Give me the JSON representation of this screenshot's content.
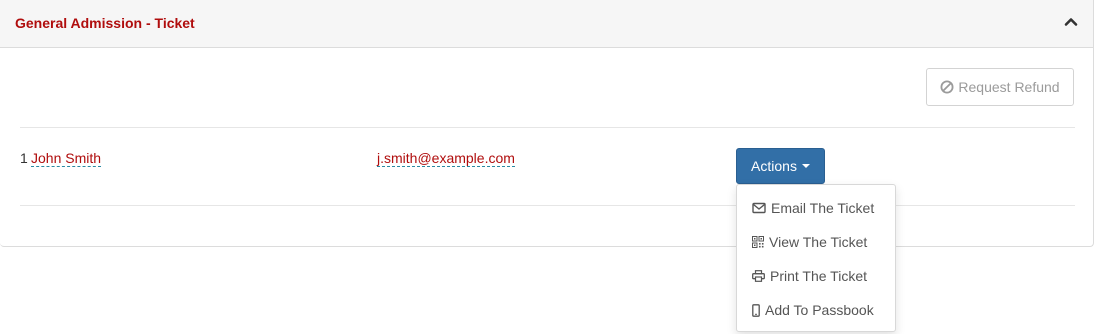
{
  "panel": {
    "title": "General Admission - Ticket",
    "collapse_icon": "chevron-up-icon"
  },
  "refund": {
    "label": "Request Refund",
    "icon": "ban-icon",
    "disabled": true
  },
  "attendee": {
    "index": "1",
    "name": "John Smith",
    "email": "j.smith@example.com"
  },
  "actions": {
    "label": "Actions",
    "menu": [
      {
        "label": "Email The Ticket",
        "icon": "envelope-icon"
      },
      {
        "label": "View The Ticket",
        "icon": "qrcode-icon"
      },
      {
        "label": "Print The Ticket",
        "icon": "print-icon"
      },
      {
        "label": "Add To Passbook",
        "icon": "mobile-icon"
      }
    ]
  },
  "colors": {
    "brand_red": "#b00d0d",
    "primary_button": "#326fa7",
    "heading_bg": "#f6f6f6"
  }
}
